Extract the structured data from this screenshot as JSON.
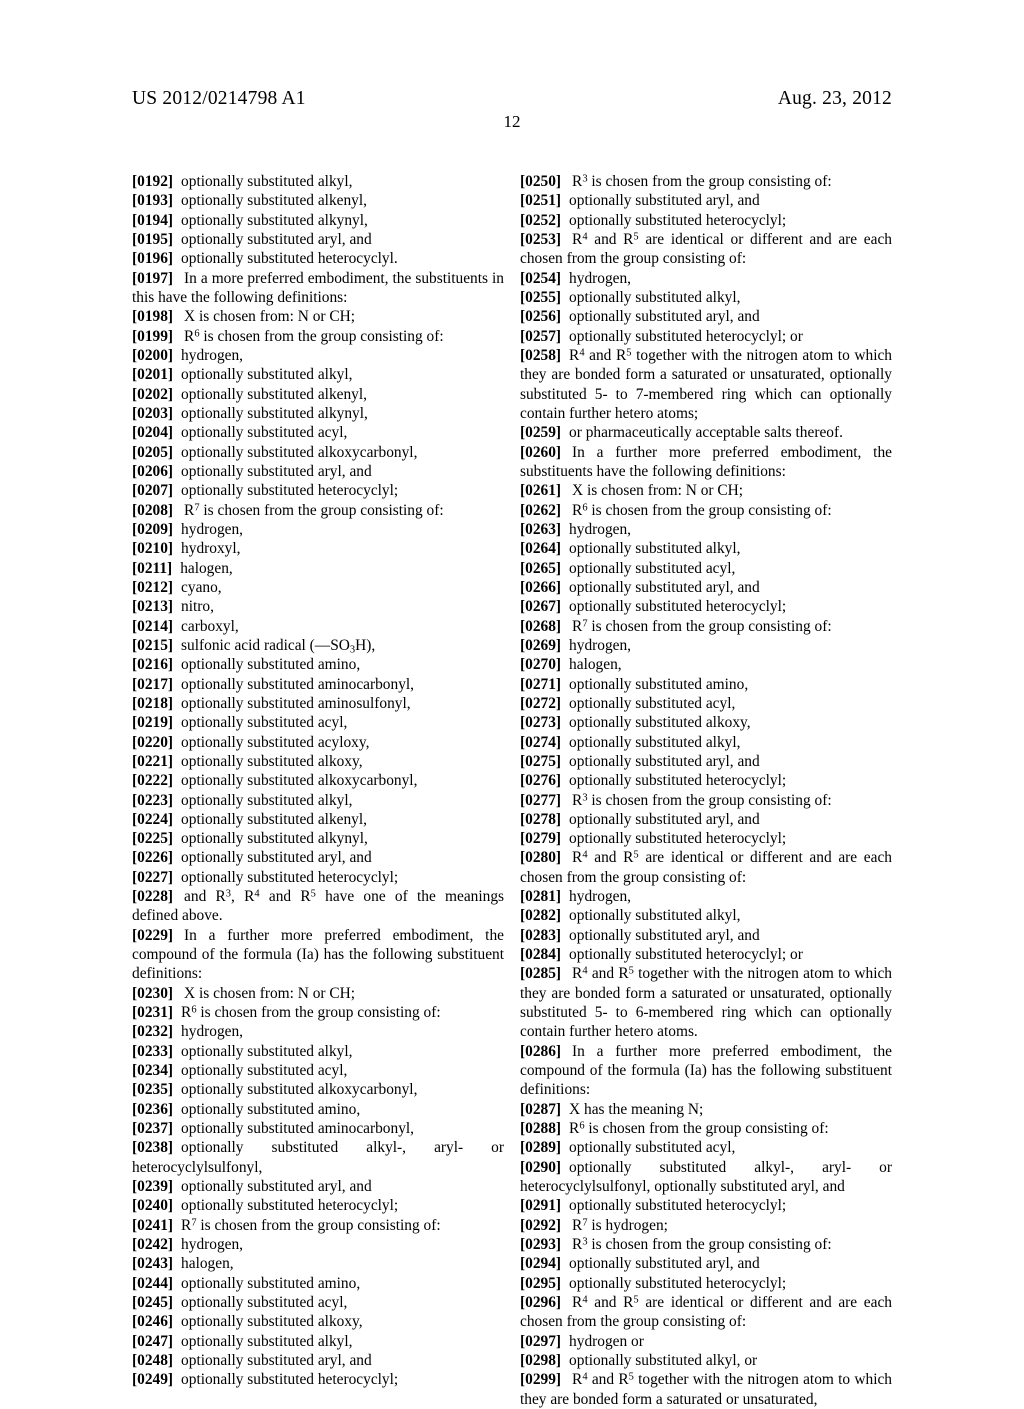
{
  "header": {
    "publication_number": "US 2012/0214798 A1",
    "date": "Aug. 23, 2012",
    "page_number": "12"
  },
  "left_column": [
    {
      "tag": "[0192]",
      "text": "optionally substituted alkyl,",
      "indent": 2
    },
    {
      "tag": "[0193]",
      "text": "optionally substituted alkenyl,",
      "indent": 2
    },
    {
      "tag": "[0194]",
      "text": "optionally substituted alkynyl,",
      "indent": 2
    },
    {
      "tag": "[0195]",
      "text": "optionally substituted aryl, and",
      "indent": 2
    },
    {
      "tag": "[0196]",
      "text": "optionally substituted heterocyclyl.",
      "indent": 2
    },
    {
      "tag": "[0197]",
      "text": "In a more preferred embodiment, the substituents in this have the following definitions:",
      "indent": 0,
      "justify": true
    },
    {
      "tag": "[0198]",
      "text": "X is chosen from: N or CH;",
      "indent": 0
    },
    {
      "tag": "[0199]",
      "text": "R6 is chosen from the group consisting of:",
      "indent": 0,
      "sup": "6",
      "pre": "R",
      "post": " is chosen from the group consisting of:"
    },
    {
      "tag": "[0200]",
      "text": "hydrogen,",
      "indent": 1
    },
    {
      "tag": "[0201]",
      "text": "optionally substituted alkyl,",
      "indent": 1
    },
    {
      "tag": "[0202]",
      "text": "optionally substituted alkenyl,",
      "indent": 1
    },
    {
      "tag": "[0203]",
      "text": "optionally substituted alkynyl,",
      "indent": 1
    },
    {
      "tag": "[0204]",
      "text": "optionally substituted acyl,",
      "indent": 1
    },
    {
      "tag": "[0205]",
      "text": "optionally substituted alkoxycarbonyl,",
      "indent": 1
    },
    {
      "tag": "[0206]",
      "text": "optionally substituted aryl, and",
      "indent": 1
    },
    {
      "tag": "[0207]",
      "text": "optionally substituted heterocyclyl;",
      "indent": 1
    },
    {
      "tag": "[0208]",
      "text": "R7 is chosen from the group consisting of:",
      "indent": 0
    },
    {
      "tag": "[0209]",
      "text": "hydrogen,",
      "indent": 1
    },
    {
      "tag": "[0210]",
      "text": "hydroxyl,",
      "indent": 1
    },
    {
      "tag": "[0211]",
      "text": "halogen,",
      "indent": 1
    },
    {
      "tag": "[0212]",
      "text": "cyano,",
      "indent": 1
    },
    {
      "tag": "[0213]",
      "text": "nitro,",
      "indent": 1
    },
    {
      "tag": "[0214]",
      "text": "carboxyl,",
      "indent": 1
    },
    {
      "tag": "[0215]",
      "text": "sulfonic acid radical (—SO3H),",
      "indent": 1
    },
    {
      "tag": "[0216]",
      "text": "optionally substituted amino,",
      "indent": 1
    },
    {
      "tag": "[0217]",
      "text": "optionally substituted aminocarbonyl,",
      "indent": 1
    },
    {
      "tag": "[0218]",
      "text": "optionally substituted aminosulfonyl,",
      "indent": 1
    },
    {
      "tag": "[0219]",
      "text": "optionally substituted acyl,",
      "indent": 1
    },
    {
      "tag": "[0220]",
      "text": "optionally substituted acyloxy,",
      "indent": 1
    },
    {
      "tag": "[0221]",
      "text": "optionally substituted alkoxy,",
      "indent": 1
    },
    {
      "tag": "[0222]",
      "text": "optionally substituted alkoxycarbonyl,",
      "indent": 1
    },
    {
      "tag": "[0223]",
      "text": "optionally substituted alkyl,",
      "indent": 1
    },
    {
      "tag": "[0224]",
      "text": "optionally substituted alkenyl,",
      "indent": 1
    },
    {
      "tag": "[0225]",
      "text": "optionally substituted alkynyl,",
      "indent": 1
    },
    {
      "tag": "[0226]",
      "text": "optionally substituted aryl, and",
      "indent": 1
    },
    {
      "tag": "[0227]",
      "text": "optionally substituted heterocyclyl;",
      "indent": 1
    },
    {
      "tag": "[0228]",
      "text": "and R3, R4 and R5 have one of the meanings defined above.",
      "indent": 0
    },
    {
      "tag": "[0229]",
      "text": "In a further more preferred embodiment, the compound of the formula (Ia) has the following substituent definitions:",
      "indent": 0
    },
    {
      "tag": "[0230]",
      "text": "X is chosen from: N or CH;",
      "indent": 0
    },
    {
      "tag": "[0231]",
      "text": "R6 is chosen from the group consisting of:",
      "indent": 1
    },
    {
      "tag": "[0232]",
      "text": "hydrogen,",
      "indent": 2
    },
    {
      "tag": "[0233]",
      "text": "optionally substituted alkyl,",
      "indent": 2
    },
    {
      "tag": "[0234]",
      "text": "optionally substituted acyl,",
      "indent": 2
    },
    {
      "tag": "[0235]",
      "text": "optionally substituted alkoxycarbonyl,",
      "indent": 2
    },
    {
      "tag": "[0236]",
      "text": "optionally substituted amino,",
      "indent": 2
    },
    {
      "tag": "[0237]",
      "text": "optionally substituted aminocarbonyl,",
      "indent": 2
    },
    {
      "tag": "[0238]",
      "text": "optionally substituted alkyl-, aryl- or heterocyclylsulfonyl,",
      "indent": 2
    },
    {
      "tag": "[0239]",
      "text": "optionally substituted aryl, and",
      "indent": 2
    },
    {
      "tag": "[0240]",
      "text": "optionally substituted heterocyclyl;",
      "indent": 2
    },
    {
      "tag": "[0241]",
      "text": "R7 is chosen from the group consisting of:",
      "indent": 1
    },
    {
      "tag": "[0242]",
      "text": "hydrogen,",
      "indent": 2
    },
    {
      "tag": "[0243]",
      "text": "halogen,",
      "indent": 2
    },
    {
      "tag": "[0244]",
      "text": "optionally substituted amino,",
      "indent": 2
    },
    {
      "tag": "[0245]",
      "text": "optionally substituted acyl,",
      "indent": 2
    },
    {
      "tag": "[0246]",
      "text": "optionally substituted alkoxy,",
      "indent": 2
    },
    {
      "tag": "[0247]",
      "text": "optionally substituted alkyl,",
      "indent": 2
    },
    {
      "tag": "[0248]",
      "text": "optionally substituted aryl, and",
      "indent": 2
    },
    {
      "tag": "[0249]",
      "text": "optionally substituted heterocyclyl;",
      "indent": 2
    }
  ],
  "right_column": [
    {
      "tag": "[0250]",
      "text": "R3 is chosen from the group consisting of:",
      "indent": 0
    },
    {
      "tag": "[0251]",
      "text": "optionally substituted aryl, and",
      "indent": 1
    },
    {
      "tag": "[0252]",
      "text": "optionally substituted heterocyclyl;",
      "indent": 1
    },
    {
      "tag": "[0253]",
      "text": "R4 and R5 are identical or different and are each chosen from the group consisting of:",
      "indent": 0
    },
    {
      "tag": "[0254]",
      "text": "hydrogen,",
      "indent": 1
    },
    {
      "tag": "[0255]",
      "text": "optionally substituted alkyl,",
      "indent": 1
    },
    {
      "tag": "[0256]",
      "text": "optionally substituted aryl, and",
      "indent": 1
    },
    {
      "tag": "[0257]",
      "text": "optionally substituted heterocyclyl; or",
      "indent": 1
    },
    {
      "tag": "[0258]",
      "text": "R4 and R5 together with the nitrogen atom to which they are bonded form a saturated or unsaturated, optionally substituted 5- to 7-membered ring which can optionally contain further hetero atoms;",
      "indent": 1
    },
    {
      "tag": "[0259]",
      "text": "or pharmaceutically acceptable salts thereof.",
      "indent": 1
    },
    {
      "tag": "[0260]",
      "text": "In a further more preferred embodiment, the substituents have the following definitions:",
      "indent": 0
    },
    {
      "tag": "[0261]",
      "text": "X is chosen from: N or CH;",
      "indent": 0
    },
    {
      "tag": "[0262]",
      "text": "R6 is chosen from the group consisting of:",
      "indent": 0
    },
    {
      "tag": "[0263]",
      "text": "hydrogen,",
      "indent": 1
    },
    {
      "tag": "[0264]",
      "text": "optionally substituted alkyl,",
      "indent": 1
    },
    {
      "tag": "[0265]",
      "text": "optionally substituted acyl,",
      "indent": 1
    },
    {
      "tag": "[0266]",
      "text": "optionally substituted aryl, and",
      "indent": 1
    },
    {
      "tag": "[0267]",
      "text": "optionally substituted heterocyclyl;",
      "indent": 1
    },
    {
      "tag": "[0268]",
      "text": "R7 is chosen from the group consisting of:",
      "indent": 0
    },
    {
      "tag": "[0269]",
      "text": "hydrogen,",
      "indent": 1
    },
    {
      "tag": "[0270]",
      "text": "halogen,",
      "indent": 1
    },
    {
      "tag": "[0271]",
      "text": "optionally substituted amino,",
      "indent": 1
    },
    {
      "tag": "[0272]",
      "text": "optionally substituted acyl,",
      "indent": 1
    },
    {
      "tag": "[0273]",
      "text": "optionally substituted alkoxy,",
      "indent": 1
    },
    {
      "tag": "[0274]",
      "text": "optionally substituted alkyl,",
      "indent": 1
    },
    {
      "tag": "[0275]",
      "text": "optionally substituted aryl, and",
      "indent": 1
    },
    {
      "tag": "[0276]",
      "text": "optionally substituted heterocyclyl;",
      "indent": 1
    },
    {
      "tag": "[0277]",
      "text": "R3 is chosen from the group consisting of:",
      "indent": 0
    },
    {
      "tag": "[0278]",
      "text": "optionally substituted aryl, and",
      "indent": 1
    },
    {
      "tag": "[0279]",
      "text": "optionally substituted heterocyclyl;",
      "indent": 1
    },
    {
      "tag": "[0280]",
      "text": "R4 and R5 are identical or different and are each chosen from the group consisting of:",
      "indent": 0
    },
    {
      "tag": "[0281]",
      "text": "hydrogen,",
      "indent": 1
    },
    {
      "tag": "[0282]",
      "text": "optionally substituted alkyl,",
      "indent": 1
    },
    {
      "tag": "[0283]",
      "text": "optionally substituted aryl, and",
      "indent": 1
    },
    {
      "tag": "[0284]",
      "text": "optionally substituted heterocyclyl; or",
      "indent": 1
    },
    {
      "tag": "[0285]",
      "text": "R4 and R5 together with the nitrogen atom to which they are bonded form a saturated or unsaturated, optionally substituted 5- to 6-membered ring which can optionally contain further hetero atoms.",
      "indent": 0
    },
    {
      "tag": "[0286]",
      "text": "In a further more preferred embodiment, the compound of the formula (Ia) has the following substituent definitions:",
      "indent": 0
    },
    {
      "tag": "[0287]",
      "text": "X has the meaning N;",
      "indent": 1
    },
    {
      "tag": "[0288]",
      "text": "R6 is chosen from the group consisting of:",
      "indent": 1
    },
    {
      "tag": "[0289]",
      "text": "optionally substituted acyl,",
      "indent": 2
    },
    {
      "tag": "[0290]",
      "text": "optionally substituted alkyl-, aryl- or heterocyclylsulfonyl, optionally substituted aryl, and",
      "indent": 2
    },
    {
      "tag": "[0291]",
      "text": "optionally substituted heterocyclyl;",
      "indent": 2
    },
    {
      "tag": "[0292]",
      "text": "R7 is hydrogen;",
      "indent": 0
    },
    {
      "tag": "[0293]",
      "text": "R3 is chosen from the group consisting of:",
      "indent": 0
    },
    {
      "tag": "[0294]",
      "text": "optionally substituted aryl, and",
      "indent": 1
    },
    {
      "tag": "[0295]",
      "text": "optionally substituted heterocyclyl;",
      "indent": 1
    },
    {
      "tag": "[0296]",
      "text": "R4 and R5 are identical or different and are each chosen from the group consisting of:",
      "indent": 0
    },
    {
      "tag": "[0297]",
      "text": "hydrogen or",
      "indent": 1
    },
    {
      "tag": "[0298]",
      "text": "optionally substituted alkyl, or",
      "indent": 1
    },
    {
      "tag": "[0299]",
      "text": "R4 and R5 together with the nitrogen atom to which they are bonded form a saturated or unsaturated,",
      "indent": 0
    }
  ]
}
